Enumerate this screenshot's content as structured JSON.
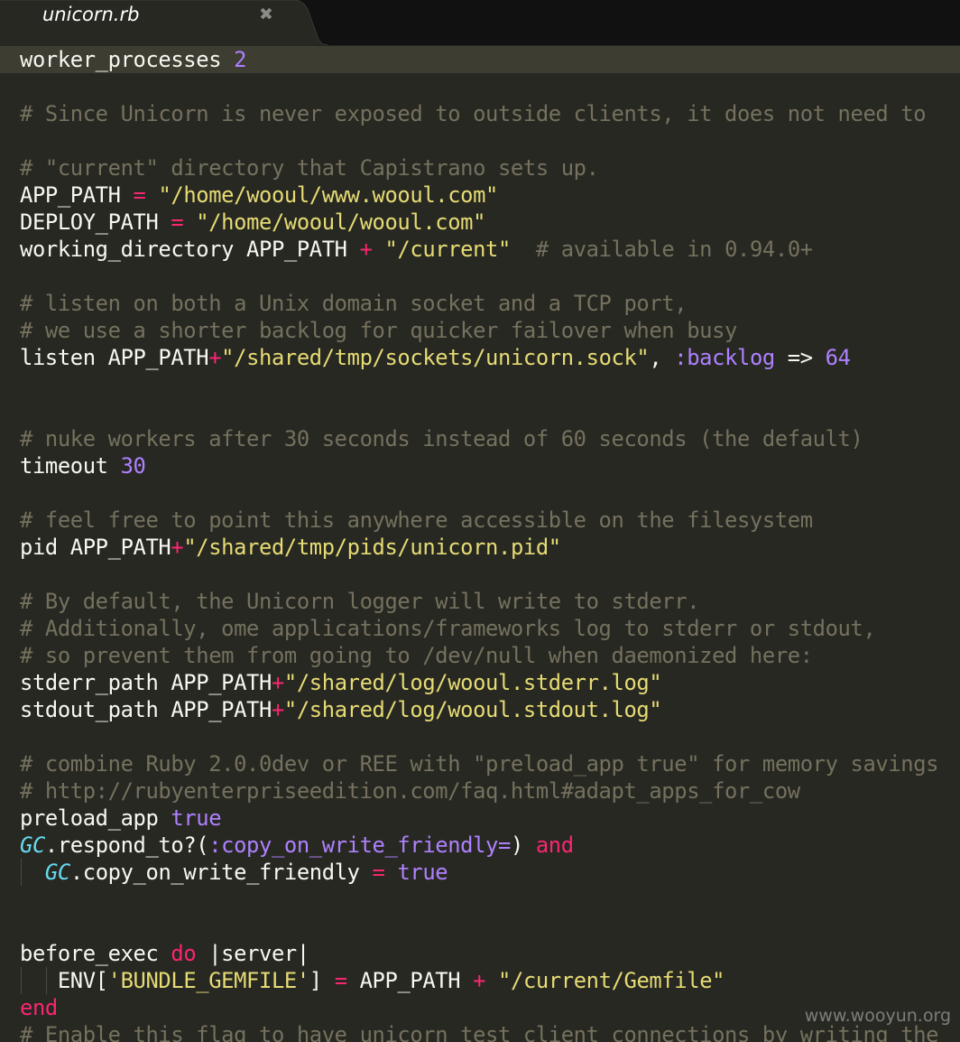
{
  "tab": {
    "filename": "unicorn.rb",
    "close_glyph": "✖"
  },
  "editor": {
    "theme": {
      "background": "#272822",
      "current_line": "#3e3d32",
      "plain": "#f8f8f2",
      "comment": "#75715e",
      "string": "#e6db74",
      "number": "#ae81ff",
      "keyword": "#f92672",
      "class": "#66d9ef"
    },
    "lines": [
      [
        [
          "plain",
          "worker_processes "
        ],
        [
          "number",
          "2"
        ]
      ],
      [],
      [
        [
          "comment",
          "# Since Unicorn is never exposed to outside clients, it does not need to"
        ]
      ],
      [],
      [
        [
          "comment",
          "# \"current\" directory that Capistrano sets up."
        ]
      ],
      [
        [
          "plain",
          "APP_PATH "
        ],
        [
          "operator",
          "="
        ],
        [
          "plain",
          " "
        ],
        [
          "string",
          "\"/home/wooul/www.wooul.com\""
        ]
      ],
      [
        [
          "plain",
          "DEPLOY_PATH "
        ],
        [
          "operator",
          "="
        ],
        [
          "plain",
          " "
        ],
        [
          "string",
          "\"/home/wooul/wooul.com\""
        ]
      ],
      [
        [
          "plain",
          "working_directory APP_PATH "
        ],
        [
          "operator",
          "+"
        ],
        [
          "plain",
          " "
        ],
        [
          "string",
          "\"/current\""
        ],
        [
          "plain",
          "  "
        ],
        [
          "comment",
          "# available in 0.94.0+"
        ]
      ],
      [],
      [
        [
          "comment",
          "# listen on both a Unix domain socket and a TCP port,"
        ]
      ],
      [
        [
          "comment",
          "# we use a shorter backlog for quicker failover when busy"
        ]
      ],
      [
        [
          "plain",
          "listen APP_PATH"
        ],
        [
          "operator",
          "+"
        ],
        [
          "string",
          "\"/shared/tmp/sockets/unicorn.sock\""
        ],
        [
          "plain",
          ", "
        ],
        [
          "symbol",
          ":backlog"
        ],
        [
          "plain",
          " => "
        ],
        [
          "number",
          "64"
        ]
      ],
      [],
      [],
      [
        [
          "comment",
          "# nuke workers after 30 seconds instead of 60 seconds (the default)"
        ]
      ],
      [
        [
          "plain",
          "timeout "
        ],
        [
          "number",
          "30"
        ]
      ],
      [],
      [
        [
          "comment",
          "# feel free to point this anywhere accessible on the filesystem"
        ]
      ],
      [
        [
          "plain",
          "pid APP_PATH"
        ],
        [
          "operator",
          "+"
        ],
        [
          "string",
          "\"/shared/tmp/pids/unicorn.pid\""
        ]
      ],
      [],
      [
        [
          "comment",
          "# By default, the Unicorn logger will write to stderr."
        ]
      ],
      [
        [
          "comment",
          "# Additionally, ome applications/frameworks log to stderr or stdout,"
        ]
      ],
      [
        [
          "comment",
          "# so prevent them from going to /dev/null when daemonized here:"
        ]
      ],
      [
        [
          "plain",
          "stderr_path APP_PATH"
        ],
        [
          "operator",
          "+"
        ],
        [
          "string",
          "\"/shared/log/wooul.stderr.log\""
        ]
      ],
      [
        [
          "plain",
          "stdout_path APP_PATH"
        ],
        [
          "operator",
          "+"
        ],
        [
          "string",
          "\"/shared/log/wooul.stdout.log\""
        ]
      ],
      [],
      [
        [
          "comment",
          "# combine Ruby 2.0.0dev or REE with \"preload_app true\" for memory savings"
        ]
      ],
      [
        [
          "comment",
          "# http://rubyenterpriseedition.com/faq.html#adapt_apps_for_cow"
        ]
      ],
      [
        [
          "plain",
          "preload_app "
        ],
        [
          "constant",
          "true"
        ]
      ],
      [
        [
          "class",
          "GC"
        ],
        [
          "plain",
          ".respond_to?("
        ],
        [
          "symbol",
          ":copy_on_write_friendly="
        ],
        [
          "plain",
          ") "
        ],
        [
          "keyword",
          "and"
        ]
      ],
      [
        [
          "plain",
          "  "
        ],
        [
          "class",
          "GC"
        ],
        [
          "plain",
          ".copy_on_write_friendly "
        ],
        [
          "operator",
          "="
        ],
        [
          "plain",
          " "
        ],
        [
          "constant",
          "true"
        ]
      ],
      [],
      [],
      [
        [
          "plain",
          "before_exec "
        ],
        [
          "keyword",
          "do"
        ],
        [
          "plain",
          " |server|"
        ]
      ],
      [
        [
          "plain",
          "   ENV["
        ],
        [
          "string",
          "'BUNDLE_GEMFILE'"
        ],
        [
          "plain",
          "] "
        ],
        [
          "operator",
          "="
        ],
        [
          "plain",
          " APP_PATH "
        ],
        [
          "operator",
          "+"
        ],
        [
          "plain",
          " "
        ],
        [
          "string",
          "\"/current/Gemfile\""
        ]
      ],
      [
        [
          "keyword",
          "end"
        ]
      ],
      [
        [
          "comment",
          "# Enable this flag to have unicorn test client connections by writing the"
        ]
      ]
    ]
  },
  "watermark": "www.wooyun.org"
}
